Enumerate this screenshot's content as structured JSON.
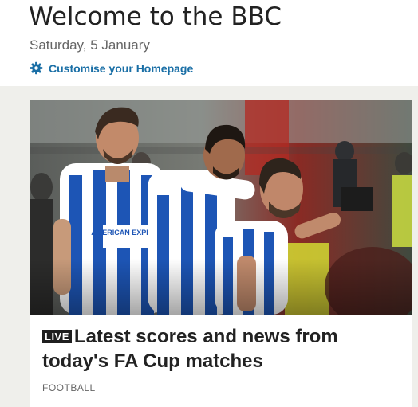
{
  "header": {
    "title": "Welcome to the BBC",
    "date": "Saturday, 5 January",
    "customise_label": "Customise your Homepage"
  },
  "lead_story": {
    "live_badge": "LIVE",
    "headline": "Latest scores and news from today's FA Cup matches",
    "category": "FOOTBALL",
    "image_alt": "Football players in blue and white striped kits celebrating a goal",
    "shirt_sponsor": "AMERICAN EXPRESS"
  },
  "colors": {
    "title_text": "#222222",
    "meta_text": "#666666",
    "link_blue": "#1a6fa6",
    "page_background": "#efefeb",
    "kit_blue": "#1d55b5",
    "live_badge_bg": "#1f1f1f"
  },
  "icons": {
    "customise": "gear-icon"
  }
}
